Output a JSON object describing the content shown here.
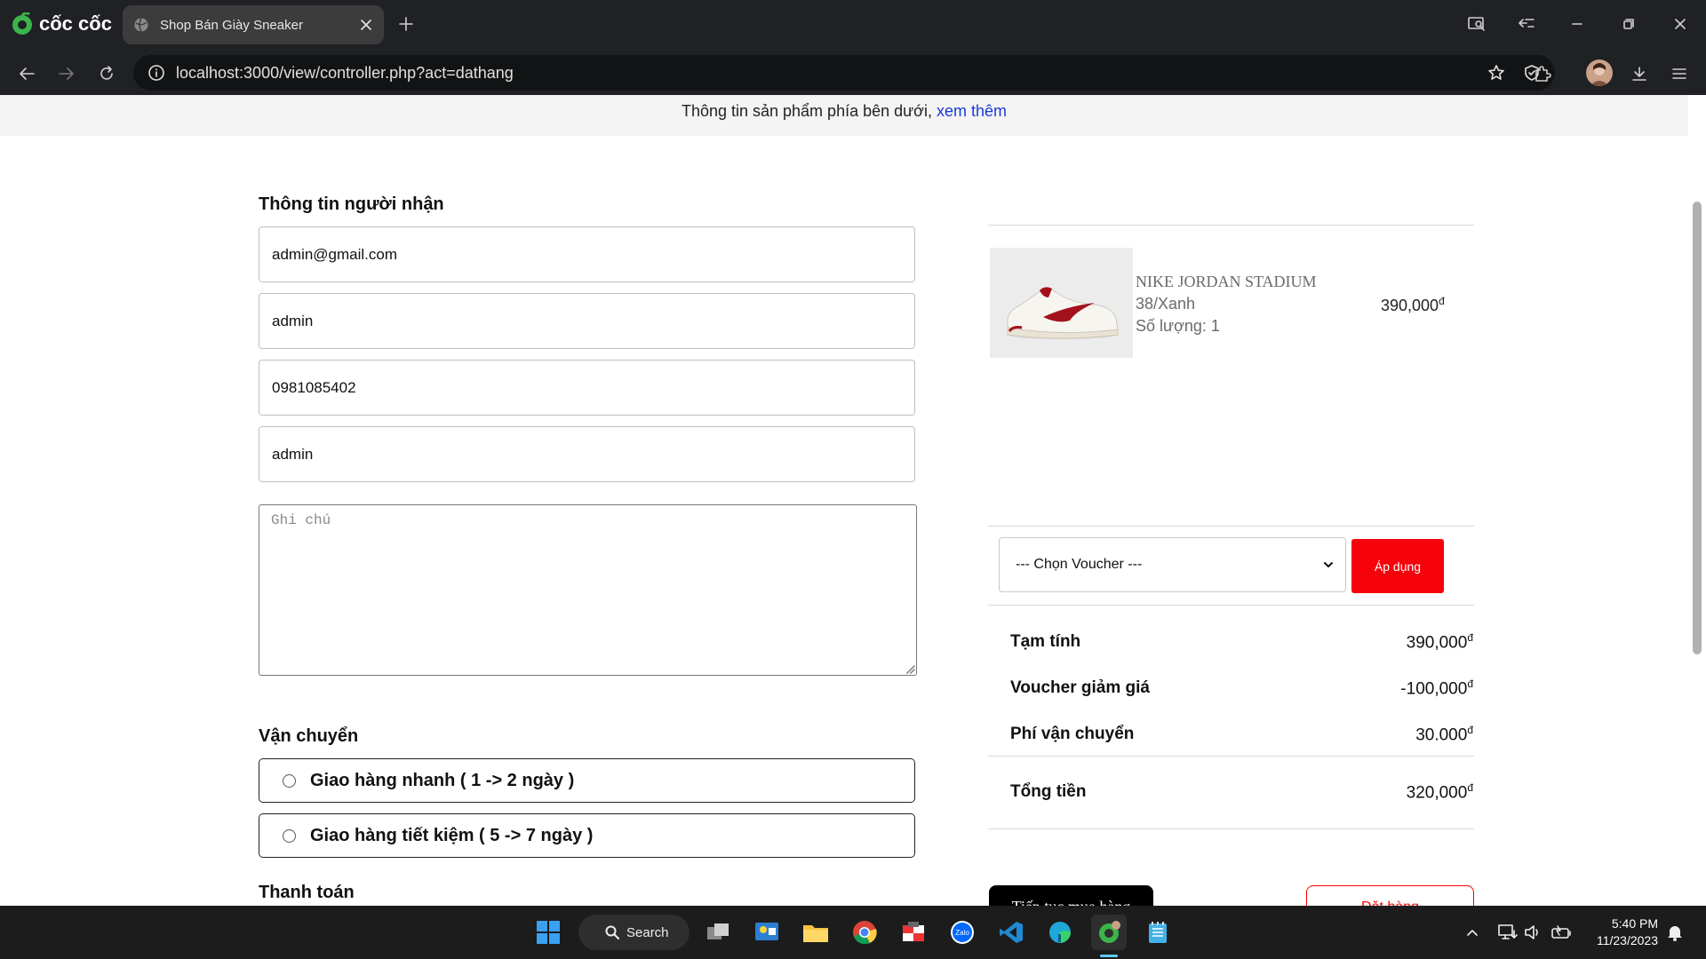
{
  "browser": {
    "brand": "cốc cốc",
    "tab_title": "Shop Bán Giày Sneaker",
    "url": "localhost:3000/view/controller.php?act=dathang"
  },
  "page": {
    "notice_text": "Thông tin sản phẩm phía bên dưới, ",
    "notice_link": "xem thêm",
    "recipient": {
      "heading": "Thông tin người nhận",
      "email": "admin@gmail.com",
      "name": "admin",
      "phone": "0981085402",
      "address": "admin",
      "note_placeholder": "Ghi chú"
    },
    "shipping": {
      "heading": "Vận chuyển",
      "options": [
        "Giao hàng nhanh ( 1 -> 2 ngày )",
        "Giao hàng tiết kiệm ( 5 -> 7 ngày )"
      ]
    },
    "payment_heading": "Thanh toán",
    "cart": {
      "product_name": "NIKE JORDAN STADIUM",
      "variant": "38/Xanh",
      "quantity": "Số lượng: 1",
      "price": "390,000",
      "currency": "đ"
    },
    "voucher": {
      "select_value": "--- Chọn Voucher ---",
      "apply_label": "Áp dụng"
    },
    "summary": {
      "subtotal_label": "Tạm tính",
      "subtotal_value": "390,000",
      "voucher_label": "Voucher giảm giá",
      "voucher_value": "-100,000",
      "shipping_label": "Phí vận chuyển",
      "shipping_value": "30.000",
      "total_label": "Tổng tiền",
      "total_value": "320,000"
    },
    "buttons": {
      "continue_label": "Tiếp tục mua hàng",
      "order_label": "Đặt hàng"
    }
  },
  "taskbar": {
    "search_label": "Search",
    "time": "5:40 PM",
    "date": "11/23/2023"
  },
  "colors": {
    "accent_red": "#f5020a",
    "link_blue": "#1a3bd6",
    "browser_dark": "#202124"
  }
}
